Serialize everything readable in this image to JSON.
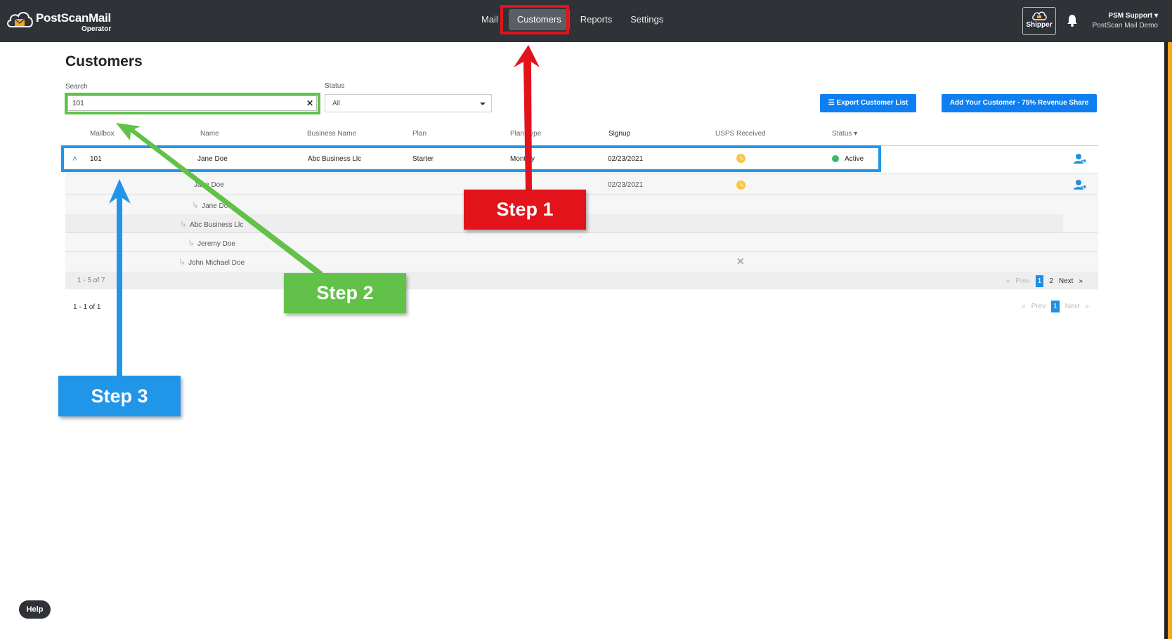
{
  "app": {
    "brand": "PostScanMail",
    "sub": "Operator"
  },
  "nav": {
    "items": [
      "Mail",
      "Customers",
      "Reports",
      "Settings"
    ],
    "active": "Customers"
  },
  "header": {
    "shipper": "Shipper",
    "user_name": "PSM Support",
    "user_org": "PostScan Mail Demo"
  },
  "page": {
    "title": "Customers"
  },
  "filters": {
    "search_label": "Search",
    "search_value": "101",
    "status_label": "Status",
    "status_value": "All"
  },
  "buttons": {
    "export": "Export Customer List",
    "add": "Add Your Customer - 75% Revenue Share"
  },
  "table": {
    "headers": [
      "Mailbox",
      "Name",
      "Business Name",
      "Plan",
      "Plan Type",
      "Signup",
      "USPS Received",
      "Status"
    ],
    "main_row": {
      "mailbox": "101",
      "name": "Jane Doe",
      "business": "Abc Business Llc",
      "plan": "Starter",
      "plan_type": "Monthly",
      "signup": "02/23/2021",
      "status": "Active"
    },
    "sub_rows": [
      {
        "name": "Jane Doe",
        "signup": "02/23/2021"
      },
      {
        "name": "Jane Doe"
      },
      {
        "name": "Abc Business Llc"
      },
      {
        "name": "Jeremy Doe"
      },
      {
        "name": "John Michael Doe"
      }
    ],
    "sub_count": "1 - 5 of 7",
    "main_count": "1 - 1 of 1"
  },
  "pager_sub": {
    "prev": "Prev",
    "pages": [
      "1",
      "2"
    ],
    "next": "Next",
    "first": "«",
    "last": "»"
  },
  "pager_main": {
    "prev": "Prev",
    "pages": [
      "1"
    ],
    "next": "Next",
    "first": "«",
    "last": "»"
  },
  "steps": [
    "Step 1",
    "Step 2",
    "Step 3"
  ],
  "help": "Help",
  "colors": {
    "step1": "#e3131b",
    "step2": "#62c148",
    "step3": "#2196e8",
    "primary": "#0d7ff2"
  }
}
